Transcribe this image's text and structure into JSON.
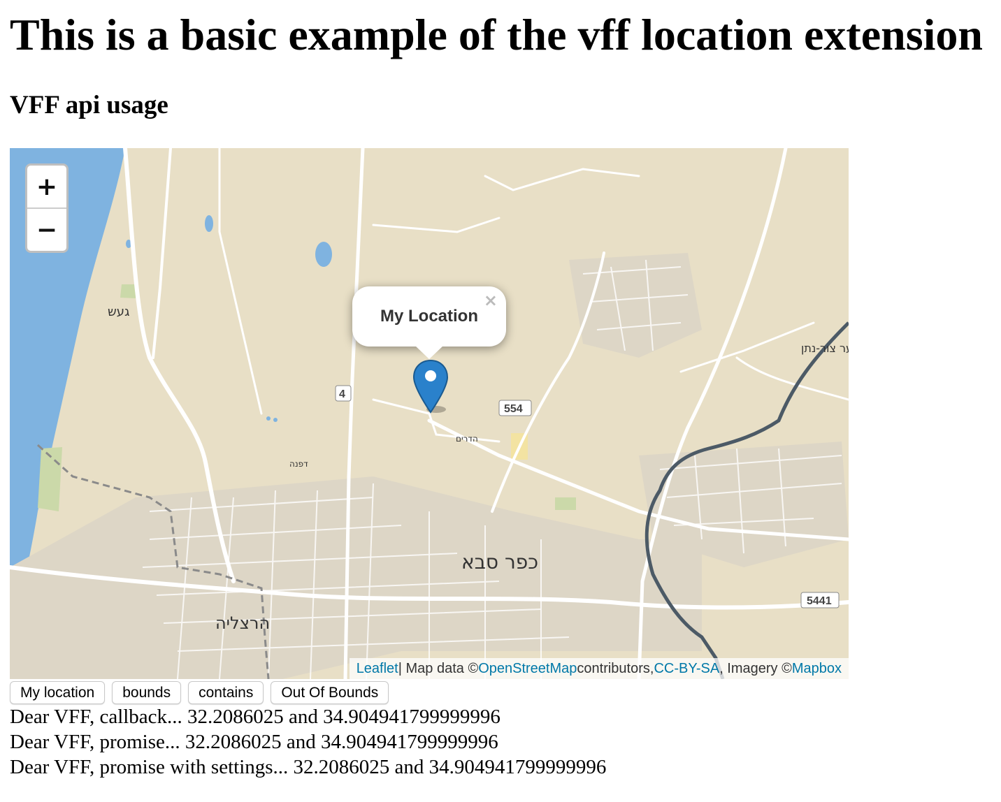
{
  "page": {
    "title": "This is a basic example of the vff location extension",
    "subtitle": "VFF api usage"
  },
  "map": {
    "zoom_in_label": "+",
    "zoom_out_label": "−",
    "popup_text": "My Location",
    "popup_close": "×",
    "attribution": {
      "leaflet": "Leaflet",
      "sep1": " | Map data © ",
      "osm": "OpenStreetMap",
      "contributors": " contributors, ",
      "license": "CC-BY-SA",
      "imagery": ", Imagery © ",
      "mapbox": "Mapbox"
    },
    "labels": {
      "city_main": "כפר סבא",
      "city_herzliya": "הרצליה",
      "gaash": "געש",
      "yaar": "יער צור-נתן",
      "dafna": "דפנה",
      "hadarim": "הדרים",
      "road_4": "4",
      "road_554": "554",
      "road_5441": "5441"
    },
    "colors": {
      "land": "#e8dfc6",
      "sea": "#7fb3e0",
      "road": "#ffffff",
      "marker": "#2a81cb",
      "link": "#0078a8"
    }
  },
  "buttons": [
    "My location",
    "bounds",
    "contains",
    "Out Of Bounds"
  ],
  "log": [
    "Dear VFF, callback... 32.2086025 and 34.904941799999996",
    "Dear VFF, promise... 32.2086025 and 34.904941799999996",
    "Dear VFF, promise with settings... 32.2086025 and 34.904941799999996"
  ]
}
